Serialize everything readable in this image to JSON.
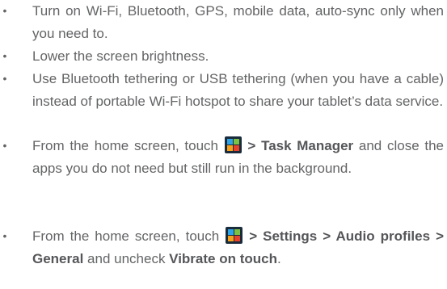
{
  "bullet_char": "•",
  "items": [
    {
      "text": "Turn on Wi-Fi, Bluetooth, GPS, mobile data, auto-sync only when you need to."
    },
    {
      "text": "Lower the screen brightness."
    },
    {
      "text": "Use Bluetooth tethering or USB tethering (when you have a cable) instead of portable Wi-Fi hotspot to share your tablet’s data service."
    },
    {
      "before_icon": "From the home screen, touch ",
      "icon": "apps-menu-icon",
      "bold_1": " > Task Manager",
      "after": " and close the apps you do not need but still run in the background."
    },
    {
      "before_icon": "From the home screen, touch ",
      "icon": "apps-menu-icon",
      "bold_1": " > Settings > Audio profiles > General",
      "mid": " and uncheck ",
      "bold_2": "Vibrate on touch",
      "end": "."
    }
  ],
  "colors": {
    "text": "#636466",
    "icon_bg": "#1a2b3c",
    "icon_tiles": [
      "#2ea3e6",
      "#7cc242",
      "#f7a11a",
      "#e8412c"
    ]
  }
}
